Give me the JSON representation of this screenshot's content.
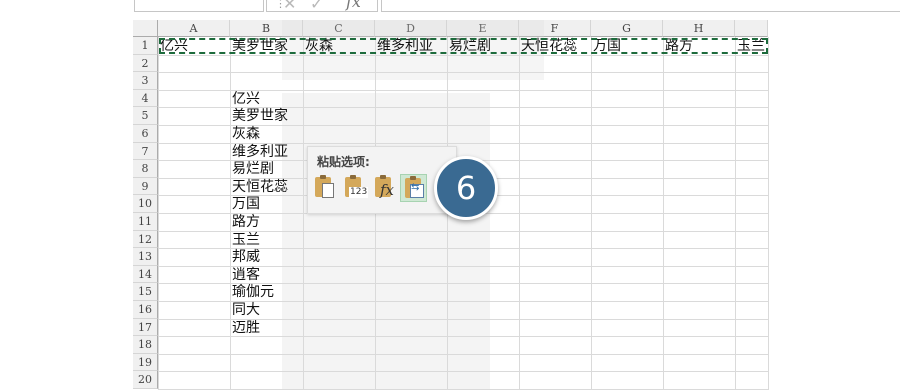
{
  "formula_bar": {
    "fx_label": "fx"
  },
  "columns": [
    "A",
    "B",
    "C",
    "D",
    "E",
    "F",
    "G",
    "H"
  ],
  "rows": [
    "1",
    "2",
    "3",
    "4",
    "5",
    "6",
    "7",
    "8",
    "9",
    "10",
    "11",
    "12",
    "13",
    "14",
    "15",
    "16",
    "17",
    "18",
    "19",
    "20"
  ],
  "row1_values": [
    "亿兴",
    "美罗世家",
    "灰森",
    "维多利亚",
    "易烂剧",
    "天恒花蕊",
    "万国",
    "路方",
    "玉兰"
  ],
  "column_b_values": [
    "亿兴",
    "美罗世家",
    "灰森",
    "维多利亚",
    "易烂剧",
    "天恒花蕊",
    "万国",
    "路方",
    "玉兰",
    "邦威",
    "逍客",
    "瑜伽元",
    "同大",
    "迈胜"
  ],
  "paste_options": {
    "title": "粘贴选项:",
    "buttons": [
      {
        "name": "paste-button",
        "icon": "paste-icon"
      },
      {
        "name": "paste-values-button",
        "icon": "paste-values-icon",
        "label": "123"
      },
      {
        "name": "paste-formulas-button",
        "icon": "paste-formulas-icon",
        "label": "fx"
      },
      {
        "name": "paste-transpose-button",
        "icon": "paste-transpose-icon",
        "selected": true
      }
    ]
  },
  "step_badge": "6",
  "colors": {
    "marquee": "#1d6b3c",
    "badge": "#3a6a92",
    "selected_button": "#cfe8d4"
  }
}
